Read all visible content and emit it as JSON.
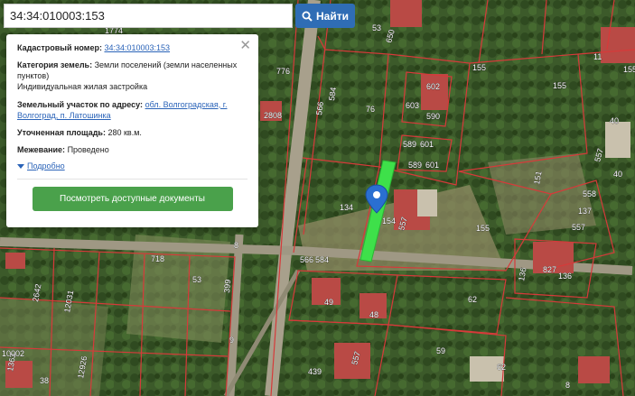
{
  "search": {
    "value": "34:34:010003:153",
    "button_label": "Найти"
  },
  "info": {
    "cadastral_label": "Кадастровый номер:",
    "cadastral_value": "34:34:010003:153",
    "category_label": "Категория земель:",
    "category_value": "Земли поселений (земли населенных пунктов)",
    "permitted_use": "Индивидуальная жилая застройка",
    "address_label": "Земельный участок по адресу:",
    "address_value": "обл. Волгоградская, г. Волгоград, п. Латошинка",
    "area_label": "Уточненная площадь:",
    "area_value": "280 кв.м.",
    "survey_label": "Межевание:",
    "survey_value": "Проведено",
    "more_label": "Подробно",
    "docs_button": "Посмотреть доступные документы"
  },
  "parcel_labels": [
    "1774",
    "53",
    "650",
    "776",
    "2808",
    "76",
    "603",
    "602",
    "590",
    "589",
    "601",
    "589",
    "601",
    "566",
    "584",
    "155",
    "155",
    "11",
    "155",
    "40",
    "40",
    "557",
    "151",
    "558",
    "137",
    "557",
    "134",
    "154",
    "557",
    "155",
    "566",
    "584",
    "136",
    "827",
    "136",
    "718",
    "53",
    "399",
    "8",
    "2642",
    "12031",
    "49",
    "48",
    "62",
    "59",
    "62",
    "439",
    "557",
    "9",
    "10002",
    "1363",
    "12926",
    "38",
    "8"
  ],
  "colors": {
    "parcel_border": "#d63a3a",
    "selected_parcel": "#3ee04a",
    "marker": "#2a6fd1"
  }
}
